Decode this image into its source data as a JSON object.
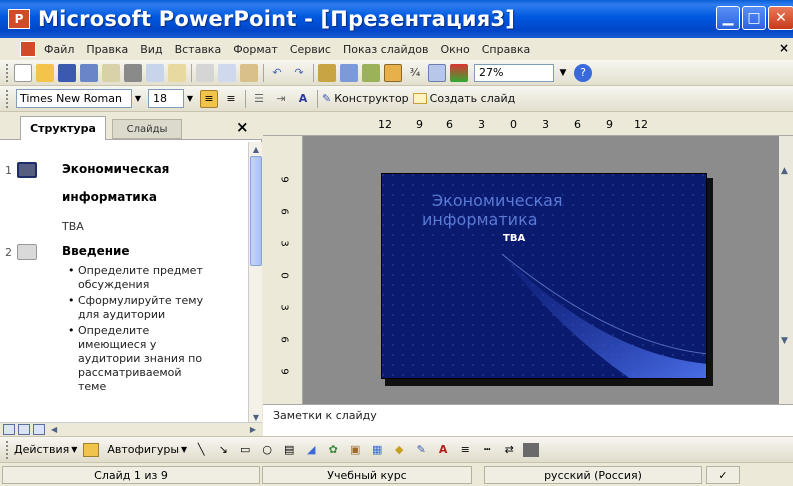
{
  "window": {
    "title": "Microsoft PowerPoint - [Презентация3]",
    "app_icon_letter": "P"
  },
  "menu": {
    "items": [
      "Файл",
      "Правка",
      "Вид",
      "Вставка",
      "Формат",
      "Сервис",
      "Показ слайдов",
      "Окно",
      "Справка"
    ]
  },
  "toolbar1": {
    "zoom": "27%"
  },
  "toolbar2": {
    "font_name": "Times New Roman",
    "font_size": "18",
    "designer_label": "Конструктор",
    "new_slide_label": "Создать слайд"
  },
  "left_pane": {
    "tab_outline": "Структура",
    "tab_slides": "Слайды",
    "close": "×",
    "slides": [
      {
        "number": "1",
        "title_line1": "Экономическая",
        "title_line2": "информатика",
        "subtitle": "ТВА"
      },
      {
        "number": "2",
        "title": "Введение",
        "bullets": [
          "Определите предмет",
          "обсуждения",
          "Сформулируйте тему",
          "для аудитории",
          "Определите",
          "имеющиеся у",
          "аудитории знания по",
          "рассматриваемой",
          "теме"
        ]
      }
    ]
  },
  "ruler": {
    "h_ticks": [
      "12",
      "9",
      "6",
      "3",
      "0",
      "3",
      "6",
      "9",
      "12"
    ],
    "v_ticks": [
      "9",
      "6",
      "3",
      "0",
      "3",
      "6",
      "9"
    ]
  },
  "slide": {
    "title_line1": "Экономическая",
    "title_line2": "информатика",
    "subtitle": "ТВА",
    "bg_color": "#0a1a6e",
    "accent_color": "#3a5fd9"
  },
  "notes": {
    "placeholder": "Заметки к слайду"
  },
  "drawbar": {
    "actions": "Действия",
    "autoshapes": "Автофигуры"
  },
  "status": {
    "slide": "Слайд 1 из 9",
    "design": "Учебный курс",
    "language": "русский (Россия)"
  }
}
